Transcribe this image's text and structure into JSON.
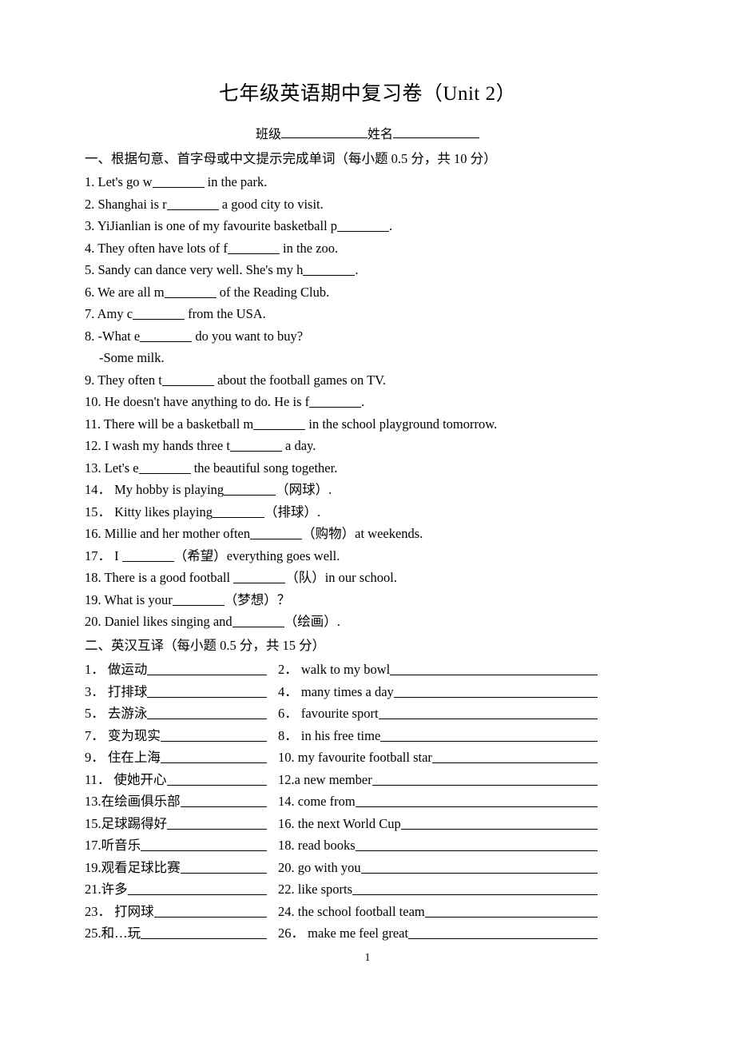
{
  "document": {
    "title": "七年级英语期中复习卷（Unit 2）",
    "subtitle": {
      "class_label": "班级",
      "name_label": "姓名"
    },
    "page_number": "1"
  },
  "section1": {
    "heading": "一、根据句意、首字母或中文提示完成单词（每小题 0.5 分，共 10 分）",
    "items": [
      {
        "num": "1.",
        "before": "Let's go w",
        "blank": true,
        "after": " in the park."
      },
      {
        "num": "2.",
        "before": "Shanghai is r",
        "blank": true,
        "after": " a good city to visit."
      },
      {
        "num": "3.",
        "before": "YiJianlian is one of my favourite basketball p",
        "blank": true,
        "after": "."
      },
      {
        "num": "4.",
        "before": "They often have lots of f",
        "blank": true,
        "after": " in the zoo."
      },
      {
        "num": "5.",
        "before": "Sandy can dance very well. She's my h",
        "blank": true,
        "after": "."
      },
      {
        "num": "6.",
        "before": "We are all m",
        "blank": true,
        "after": " of the Reading Club."
      },
      {
        "num": "7.",
        "before": "Amy c",
        "blank": true,
        "after": " from the USA."
      },
      {
        "num": "8.",
        "before": "-What e",
        "blank": true,
        "after": " do you want to buy?"
      },
      {
        "num": "",
        "before": "-Some milk.",
        "blank": false,
        "after": "",
        "continuation": true
      },
      {
        "num": "9.",
        "before": "They often t",
        "blank": true,
        "after": " about the football games on TV."
      },
      {
        "num": "10.",
        "before": "He doesn't have anything to do. He is f",
        "blank": true,
        "after": "."
      },
      {
        "num": "11.",
        "before": "There will be a basketball m",
        "blank": true,
        "after": " in the school playground tomorrow."
      },
      {
        "num": "12.",
        "before": "I wash my hands three t",
        "blank": true,
        "after": " a day."
      },
      {
        "num": "13.",
        "before": "Let's e",
        "blank": true,
        "after": " the beautiful song together."
      },
      {
        "num": "14．",
        "before": " My hobby is playing",
        "blank": true,
        "after": "（网球）."
      },
      {
        "num": "15．",
        "before": " Kitty likes playing",
        "blank": true,
        "after": "（排球）."
      },
      {
        "num": "16.",
        "before": "Millie and her mother often",
        "blank": true,
        "after": "（购物）at weekends."
      },
      {
        "num": "17．",
        "before": " I ",
        "blank": true,
        "after": "（希望）everything goes well."
      },
      {
        "num": "18.",
        "before": "There is a good football ",
        "blank": true,
        "after": "（队）in our school."
      },
      {
        "num": "19.",
        "before": "What is your",
        "blank": true,
        "after": "（梦想）？"
      },
      {
        "num": "20.",
        "before": "Daniel likes singing and",
        "blank": true,
        "after": "（绘画）."
      }
    ]
  },
  "section2": {
    "heading": "二、英汉互译（每小题 0.5 分，共 15 分）",
    "rows": [
      {
        "left": {
          "num": "1．",
          "text": " 做运动"
        },
        "right": {
          "num": "2．",
          "text": " walk to my bowl"
        }
      },
      {
        "left": {
          "num": "3．",
          "text": " 打排球"
        },
        "right": {
          "num": "4．",
          "text": " many times a day"
        }
      },
      {
        "left": {
          "num": "5．",
          "text": " 去游泳"
        },
        "right": {
          "num": "6．",
          "text": " favourite sport"
        }
      },
      {
        "left": {
          "num": "7．",
          "text": " 变为现实"
        },
        "right": {
          "num": "8．",
          "text": " in his free time"
        }
      },
      {
        "left": {
          "num": "9．",
          "text": " 住在上海"
        },
        "right": {
          "num": "10.",
          "text": " my favourite football star"
        }
      },
      {
        "left": {
          "num": "11．",
          "text": " 使她开心"
        },
        "right": {
          "num": "12.",
          "text": "a new member"
        }
      },
      {
        "left": {
          "num": "13.",
          "text": "在绘画俱乐部"
        },
        "right": {
          "num": "14.",
          "text": " come from"
        }
      },
      {
        "left": {
          "num": "15.",
          "text": "足球踢得好"
        },
        "right": {
          "num": "16.",
          "text": " the next World Cup"
        }
      },
      {
        "left": {
          "num": "17.",
          "text": "听音乐"
        },
        "right": {
          "num": "18.",
          "text": " read books"
        }
      },
      {
        "left": {
          "num": "19.",
          "text": "观看足球比赛"
        },
        "right": {
          "num": "20.",
          "text": " go with you"
        }
      },
      {
        "left": {
          "num": "21.",
          "text": "许多"
        },
        "right": {
          "num": "22.",
          "text": " like sports"
        }
      },
      {
        "left": {
          "num": "23．",
          "text": " 打网球"
        },
        "right": {
          "num": "24.",
          "text": " the school football team"
        }
      },
      {
        "left": {
          "num": "25.",
          "text": "和…玩"
        },
        "right": {
          "num": "26．",
          "text": " make me feel great"
        }
      }
    ]
  }
}
